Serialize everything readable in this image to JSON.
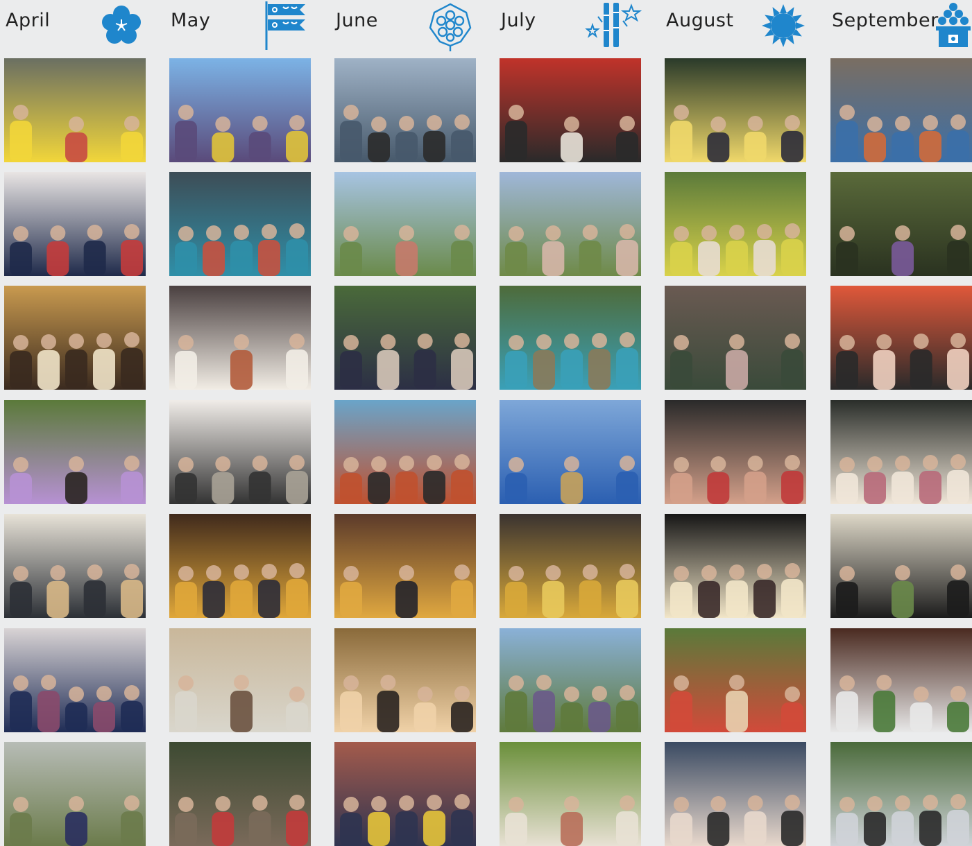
{
  "columns": [
    {
      "month": "April",
      "icon": "cherry-blossom-icon",
      "photos": [
        {
          "subject": "river-rafting",
          "palette": [
            "#6a6f62",
            "#f2d63a",
            "#c64a43"
          ]
        },
        {
          "subject": "cherry-blossoms-group",
          "palette": [
            "#e9e5e4",
            "#1f2a4a",
            "#c43c3c"
          ]
        },
        {
          "subject": "izakaya-party",
          "palette": [
            "#c99a4f",
            "#3a2a1f",
            "#f0e3c8"
          ]
        },
        {
          "subject": "lilac-blossoms",
          "palette": [
            "#5b7a3a",
            "#b791d4",
            "#2a2521"
          ]
        },
        {
          "subject": "soba-making",
          "palette": [
            "#e8e3d8",
            "#2c3036",
            "#d8b887"
          ]
        },
        {
          "subject": "kimono-friends",
          "palette": [
            "#d9d4d5",
            "#1f2c55",
            "#8a4a6b"
          ]
        },
        {
          "subject": "pond-park",
          "palette": [
            "#b7bcb6",
            "#6b7b4b",
            "#2a2f5f"
          ]
        }
      ]
    },
    {
      "month": "May",
      "icon": "koinobori-carp-streamer-icon",
      "photos": [
        {
          "subject": "tulip-field",
          "palette": [
            "#7cb3e6",
            "#5a4a7a",
            "#e0c33a"
          ]
        },
        {
          "subject": "roller-coaster",
          "palette": [
            "#3d4d56",
            "#2f8fa8",
            "#c7513f"
          ]
        },
        {
          "subject": "tea-ceremony",
          "palette": [
            "#4a4040",
            "#f2ede5",
            "#b35c3c"
          ]
        },
        {
          "subject": "pottery-class",
          "palette": [
            "#f0ece8",
            "#333333",
            "#a8a296"
          ]
        },
        {
          "subject": "game-arcade",
          "palette": [
            "#402a1c",
            "#e0a73a",
            "#2c2c38"
          ]
        },
        {
          "subject": "koto-lesson",
          "palette": [
            "#c9b79a",
            "#d9d6cc",
            "#6b5240"
          ]
        },
        {
          "subject": "forest-walk",
          "palette": [
            "#3d4a32",
            "#7a6a5a",
            "#c23b3b"
          ]
        }
      ]
    },
    {
      "month": "June",
      "icon": "hydrangea-icon",
      "photos": [
        {
          "subject": "ocean-view",
          "palette": [
            "#9fb2c6",
            "#47596b",
            "#2b2b2b"
          ]
        },
        {
          "subject": "city-sitting",
          "palette": [
            "#a7c4e3",
            "#6a8a4a",
            "#c67a6b"
          ]
        },
        {
          "subject": "market-stall",
          "palette": [
            "#4a6a3a",
            "#2c2f45",
            "#d6c6b8"
          ]
        },
        {
          "subject": "cosplay-event",
          "palette": [
            "#6aa4c9",
            "#c0512f",
            "#2a2a2a"
          ]
        },
        {
          "subject": "shop-visit",
          "palette": [
            "#5b3a2a",
            "#e0a840",
            "#23232b"
          ]
        },
        {
          "subject": "bookstore-selfie",
          "palette": [
            "#8a6a3a",
            "#f0d2a8",
            "#2a2320"
          ]
        },
        {
          "subject": "festival-street",
          "palette": [
            "#a45b4c",
            "#2f3450",
            "#e6c43a"
          ]
        }
      ]
    },
    {
      "month": "July",
      "icon": "tanabata-bamboo-icon",
      "photos": [
        {
          "subject": "torii-shrine",
          "palette": [
            "#c1332a",
            "#2a2a2a",
            "#e8e2d8"
          ]
        },
        {
          "subject": "flower-fields",
          "palette": [
            "#9fb7d9",
            "#6f8a48",
            "#d6b6a8"
          ]
        },
        {
          "subject": "blue-pond",
          "palette": [
            "#4e6b3a",
            "#3aa0b8",
            "#8a7a5a"
          ]
        },
        {
          "subject": "festival-costume",
          "palette": [
            "#7ea7d8",
            "#2b5fb1",
            "#c8a25a"
          ]
        },
        {
          "subject": "dance-studio",
          "palette": [
            "#3a3330",
            "#d8a83a",
            "#e8c95c"
          ]
        },
        {
          "subject": "lavender-field",
          "palette": [
            "#8ab1d8",
            "#5f7a3c",
            "#6a5a8a"
          ]
        },
        {
          "subject": "alpaca-farm",
          "palette": [
            "#6a8f3a",
            "#e8e1d4",
            "#b86f5a"
          ]
        }
      ]
    },
    {
      "month": "August",
      "icon": "sunflower-icon",
      "photos": [
        {
          "subject": "summer-festival",
          "palette": [
            "#2a3a2a",
            "#f0d86a",
            "#2c2c3a"
          ]
        },
        {
          "subject": "hiking-group",
          "palette": [
            "#5b7a3a",
            "#d9d24a",
            "#e7dcd2"
          ]
        },
        {
          "subject": "clock-tower",
          "palette": [
            "#6a5a52",
            "#3a4a3a",
            "#c9a8a4"
          ]
        },
        {
          "subject": "chopsticks-fun",
          "palette": [
            "#2a2a2a",
            "#d4a08a",
            "#c03a3a"
          ]
        },
        {
          "subject": "night-concert",
          "palette": [
            "#161616",
            "#f2e6c8",
            "#3a2a2a"
          ]
        },
        {
          "subject": "garden-picnic",
          "palette": [
            "#5a7a3a",
            "#d24a3a",
            "#e8d2b0"
          ]
        },
        {
          "subject": "stadium-crowd",
          "palette": [
            "#3a4a62",
            "#e8d8cc",
            "#2a2a2a"
          ]
        }
      ]
    },
    {
      "month": "September",
      "icon": "tsukimi-dango-icon",
      "photos": [
        {
          "subject": "straw-hats-temple",
          "palette": [
            "#7a6e62",
            "#3b6fa8",
            "#d06a3a"
          ]
        },
        {
          "subject": "zen-garden",
          "palette": [
            "#5a6a3a",
            "#2a3220",
            "#7a5a9a"
          ]
        },
        {
          "subject": "fushimi-inari",
          "palette": [
            "#e0583a",
            "#2a2a2a",
            "#f0d0c0"
          ]
        },
        {
          "subject": "paper-fan",
          "palette": [
            "#2a2e2a",
            "#f0e6d8",
            "#b86a7a"
          ]
        },
        {
          "subject": "flower-arranging",
          "palette": [
            "#ded8c8",
            "#1c1c1c",
            "#6a8a4a"
          ]
        },
        {
          "subject": "kendo-hall",
          "palette": [
            "#4a2a20",
            "#e8e8e8",
            "#4a7a3a"
          ]
        },
        {
          "subject": "umbrella-garden",
          "palette": [
            "#4a6a3a",
            "#cfd3d8",
            "#2a2a2a"
          ]
        }
      ]
    }
  ]
}
